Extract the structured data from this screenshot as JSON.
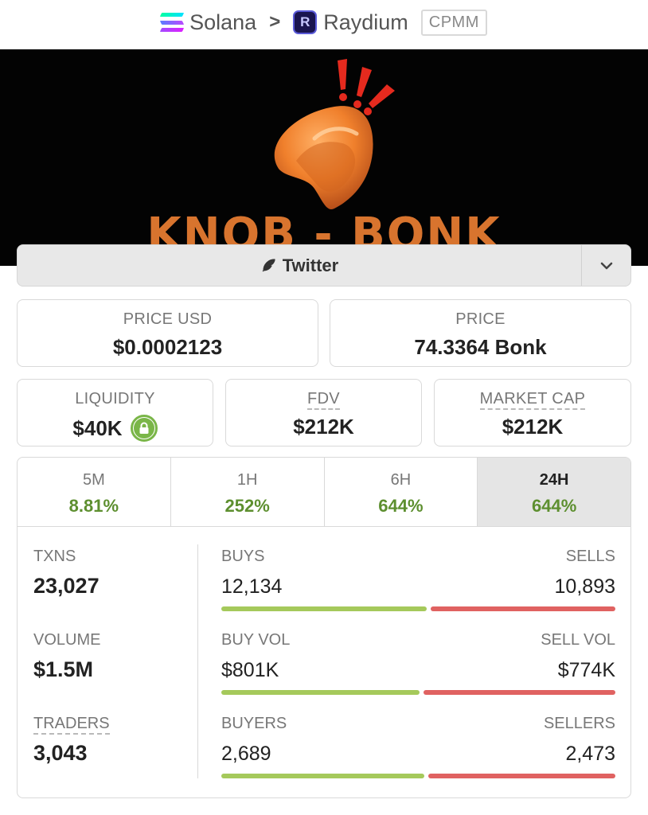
{
  "breadcrumb": {
    "chain": "Solana",
    "separator": ">",
    "dex": "Raydium",
    "dex_icon_letter": "R",
    "pool_type": "CPMM"
  },
  "banner": {
    "text": "KNOB - BONK"
  },
  "social": {
    "label": "Twitter",
    "icon": "feather-icon",
    "toggle_icon": "chevron-down-icon"
  },
  "stats": {
    "price_usd": {
      "label": "PRICE USD",
      "value": "$0.0002123"
    },
    "price": {
      "label": "PRICE",
      "value": "74.3364 Bonk"
    },
    "liquidity": {
      "label": "LIQUIDITY",
      "value": "$40K",
      "icon": "lock-icon"
    },
    "fdv": {
      "label": "FDV",
      "value": "$212K"
    },
    "market_cap": {
      "label": "MARKET CAP",
      "value": "$212K"
    }
  },
  "timeframes": [
    {
      "label": "5M",
      "change": "8.81%"
    },
    {
      "label": "1H",
      "change": "252%"
    },
    {
      "label": "6H",
      "change": "644%"
    },
    {
      "label": "24H",
      "change": "644%",
      "active": true
    }
  ],
  "details": {
    "txns": {
      "label": "TXNS",
      "value": "23,027",
      "left_label": "BUYS",
      "left_value": "12,134",
      "right_label": "SELLS",
      "right_value": "10,893",
      "buy_fraction": 0.527
    },
    "volume": {
      "label": "VOLUME",
      "value": "$1.5M",
      "left_label": "BUY VOL",
      "left_value": "$801K",
      "right_label": "SELL VOL",
      "right_value": "$774K",
      "buy_fraction": 0.509
    },
    "traders": {
      "label": "TRADERS",
      "value": "3,043",
      "left_label": "BUYERS",
      "left_value": "2,689",
      "right_label": "SELLERS",
      "right_value": "2,473",
      "buy_fraction": 0.521
    }
  },
  "colors": {
    "positive": "#5d8f2f",
    "buy_bar": "#a5c95b",
    "sell_bar": "#e06261",
    "lock": "#7ab648"
  }
}
